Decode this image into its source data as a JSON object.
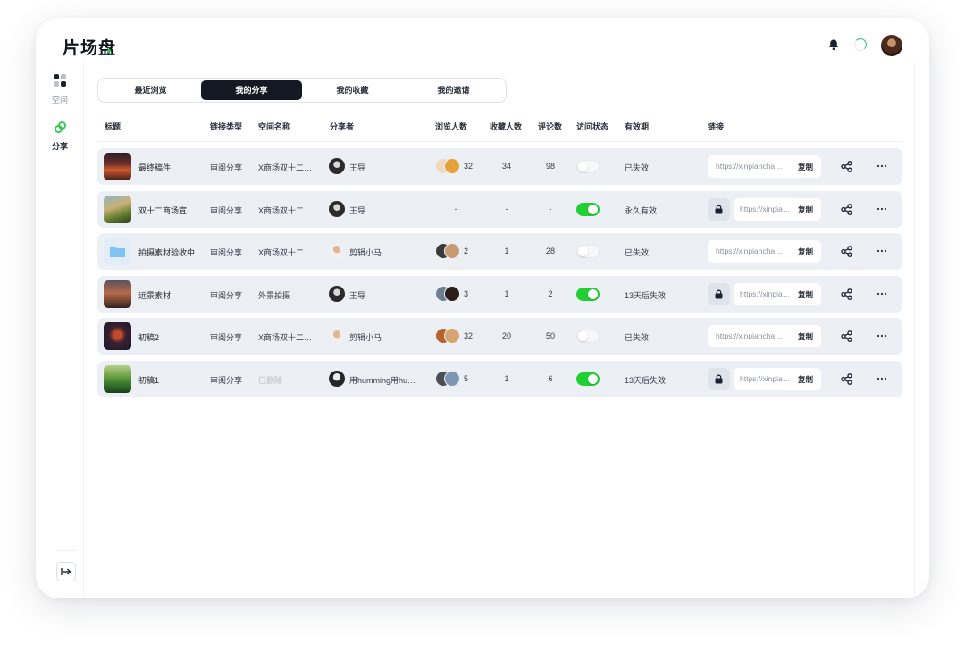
{
  "app": {
    "title": "片场盘"
  },
  "sidebar": {
    "items": [
      {
        "label": "空间",
        "icon": "grid-icon"
      },
      {
        "label": "分享",
        "icon": "link-icon",
        "active": true
      }
    ],
    "collapse_icon": "collapse-arrow-icon"
  },
  "tabs": [
    {
      "label": "最近浏览",
      "active": false
    },
    {
      "label": "我的分享",
      "active": true
    },
    {
      "label": "我的收藏",
      "active": false
    },
    {
      "label": "我的邀请",
      "active": false
    }
  ],
  "table": {
    "columns": [
      "标题",
      "链接类型",
      "空间名称",
      "分享者",
      "浏览人数",
      "收藏人数",
      "评论数",
      "访问状态",
      "有效期",
      "链接"
    ],
    "rows": [
      {
        "title": "最终稿件",
        "type": "审阅分享",
        "space": "X商场双十二…",
        "space_deleted": false,
        "sharer": "王导",
        "views": "32",
        "favorites": "34",
        "comments": "98",
        "access_on": false,
        "expiry": "已失效",
        "locked": false,
        "link": "https://xinpiancha…",
        "copy": "复制"
      },
      {
        "title": "双十二商场宣…",
        "type": "审阅分享",
        "space": "X商场双十二…",
        "space_deleted": false,
        "sharer": "王导",
        "views": "-",
        "favorites": "-",
        "comments": "-",
        "access_on": true,
        "expiry": "永久有效",
        "locked": true,
        "link": "https://xinpia…",
        "copy": "复制"
      },
      {
        "title": "拍摄素材验收中",
        "type": "审阅分享",
        "space": "X商场双十二…",
        "space_deleted": false,
        "sharer": "剪辑小马",
        "views": "2",
        "favorites": "1",
        "comments": "28",
        "access_on": false,
        "expiry": "已失效",
        "locked": false,
        "link": "https://xinpiancha…",
        "copy": "复制"
      },
      {
        "title": "远景素材",
        "type": "审阅分享",
        "space": "外景拍摄",
        "space_deleted": false,
        "sharer": "王导",
        "views": "3",
        "favorites": "1",
        "comments": "2",
        "access_on": true,
        "expiry": "13天后失效",
        "locked": true,
        "link": "https://xinpia…",
        "copy": "复制"
      },
      {
        "title": "初稿2",
        "type": "审阅分享",
        "space": "X商场双十二…",
        "space_deleted": false,
        "sharer": "剪辑小马",
        "views": "32",
        "favorites": "20",
        "comments": "50",
        "access_on": false,
        "expiry": "已失效",
        "locked": false,
        "link": "https://xinpiancha…",
        "copy": "复制"
      },
      {
        "title": "初稿1",
        "type": "审阅分享",
        "space": "已删除",
        "space_deleted": true,
        "sharer": "用humming用hu…",
        "views": "5",
        "favorites": "1",
        "comments": "6",
        "access_on": true,
        "expiry": "13天后失效",
        "locked": true,
        "link": "https://xinpia…",
        "copy": "复制"
      }
    ]
  },
  "colors": {
    "accent_green": "#1fcf34",
    "active_tab": "#141924",
    "row_bg": "#ecf0f4"
  }
}
